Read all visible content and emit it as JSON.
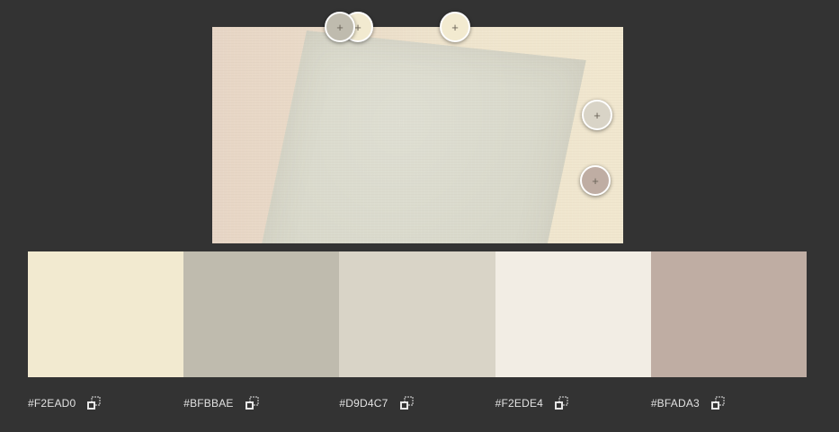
{
  "source_image": {
    "description_icon": "painting-thumbnail"
  },
  "pickers": [
    {
      "color": "#BFBBAE",
      "icon": "plus-icon",
      "glyph": "+"
    },
    {
      "color": "#F2EAD0",
      "icon": "plus-icon",
      "glyph": "+"
    },
    {
      "color": "#F2EAD0",
      "icon": "plus-icon",
      "glyph": "+"
    },
    {
      "color": "#D9D4C7",
      "icon": "plus-icon",
      "glyph": "+"
    },
    {
      "color": "#BFADA3",
      "icon": "plus-icon",
      "glyph": "+"
    }
  ],
  "swatches": [
    {
      "hex": "#F2EAD0",
      "color": "#F2EAD0",
      "copy_icon": "copy-icon"
    },
    {
      "hex": "#BFBBAE",
      "color": "#BFBBAE",
      "copy_icon": "copy-icon"
    },
    {
      "hex": "#D9D4C7",
      "color": "#D9D4C7",
      "copy_icon": "copy-icon"
    },
    {
      "hex": "#F2EDE4",
      "color": "#F2EDE4",
      "copy_icon": "copy-icon"
    },
    {
      "hex": "#BFADA3",
      "color": "#BFADA3",
      "copy_icon": "copy-icon"
    }
  ]
}
